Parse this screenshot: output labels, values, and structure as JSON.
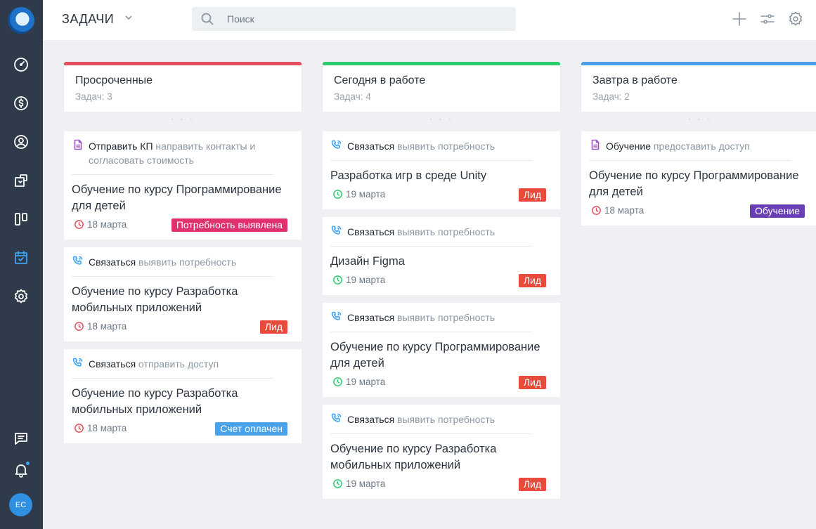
{
  "colors": {
    "sidebar_bg": "#2f3b4a",
    "accent": "#3ea3f0",
    "overdue": "#e0505e",
    "today": "#2ecc71",
    "tomorrow": "#4a9eea",
    "badge_need": "#e0306e",
    "badge_lead": "#e84a3c",
    "badge_paid": "#4aa3e8",
    "badge_training": "#6a3fb5"
  },
  "sidebar": {
    "items": [
      {
        "icon": "gauge-icon"
      },
      {
        "icon": "dollar-icon"
      },
      {
        "icon": "user-circle-icon"
      },
      {
        "icon": "box-icon"
      },
      {
        "icon": "kanban-icon"
      },
      {
        "icon": "calendar-check-icon",
        "active": true
      },
      {
        "icon": "gear-icon"
      }
    ],
    "bottom": [
      {
        "icon": "chat-icon"
      },
      {
        "icon": "bell-icon"
      }
    ],
    "avatar_initials": "EC"
  },
  "topbar": {
    "title": "ЗАДАЧИ",
    "search_placeholder": "Поиск"
  },
  "columns": [
    {
      "title": "Просроченные",
      "count": "Задач: 3",
      "dots": "· · ·",
      "cards": [
        {
          "type": "doc",
          "action": "Отправить КП",
          "desc": "направить контакты  и согласовать стоимость",
          "title": "Обучение по курсу Программирование для детей",
          "date": "18 марта",
          "badge": "Потребность выявлена",
          "badge_kind": "need",
          "date_color": "red"
        },
        {
          "type": "call",
          "action": "Связаться",
          "desc": "выявить потребность",
          "title": "Обучение по курсу Разработка мобильных приложений",
          "date": "18 марта",
          "badge": "Лид",
          "badge_kind": "lead",
          "date_color": "red"
        },
        {
          "type": "call",
          "action": "Связаться",
          "desc": "отправить доступ",
          "title": "Обучение по курсу Разработка мобильных приложений",
          "date": "18 марта",
          "badge": "Счет оплачен",
          "badge_kind": "paid",
          "date_color": "red"
        }
      ]
    },
    {
      "title": "Сегодня в работе",
      "count": "Задач: 4",
      "dots": "· · ·",
      "cards": [
        {
          "type": "call",
          "action": "Связаться",
          "desc": "выявить потребность",
          "title": "Разработка игр в среде Unity",
          "date": "19 марта",
          "badge": "Лид",
          "badge_kind": "lead",
          "date_color": "green"
        },
        {
          "type": "call",
          "action": "Связаться",
          "desc": "выявить потребность",
          "title": "Дизайн Figma",
          "date": "19 марта",
          "badge": "Лид",
          "badge_kind": "lead",
          "date_color": "green"
        },
        {
          "type": "call",
          "action": "Связаться",
          "desc": "выявить потребность",
          "title": "Обучение по курсу Программирование для детей",
          "date": "19 марта",
          "badge": "Лид",
          "badge_kind": "lead",
          "date_color": "green"
        },
        {
          "type": "call",
          "action": "Связаться",
          "desc": "выявить потребность",
          "title": "Обучение по курсу Разработка мобильных приложений",
          "date": "19 марта",
          "badge": "Лид",
          "badge_kind": "lead",
          "date_color": "green"
        }
      ]
    },
    {
      "title": "Завтра в работе",
      "count": "Задач: 2",
      "dots": "· · ·",
      "cards": [
        {
          "type": "doc",
          "action": "Обучение",
          "desc": "предоставить доступ",
          "title": "Обучение по курсу Программирование для детей",
          "date": "18 марта",
          "badge": "Обучение",
          "badge_kind": "training",
          "date_color": "red"
        }
      ]
    }
  ]
}
